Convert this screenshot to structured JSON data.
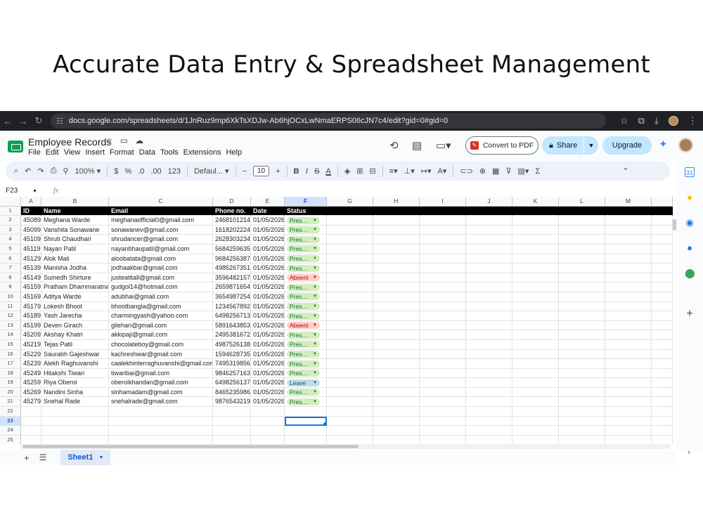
{
  "headline": "Accurate Data Entry & Spreadsheet Management",
  "browser": {
    "url": "docs.google.com/spreadsheets/d/1JnRuz9mp6XkTsXDJw-Ab6hjOCxLwNmaERPS06cJN7c4/edit?gid=0#gid=0",
    "icons": [
      "back-icon",
      "forward-icon",
      "reload-icon",
      "site-info-icon",
      "star-icon",
      "extensions-icon",
      "download-icon",
      "profile-icon",
      "menu-icon"
    ]
  },
  "sheets": {
    "title": "Employee Records",
    "menu": [
      "File",
      "Edit",
      "View",
      "Insert",
      "Format",
      "Data",
      "Tools",
      "Extensions",
      "Help"
    ],
    "convert_pdf_label": "Convert to PDF",
    "share_label": "Share",
    "upgrade_label": "Upgrade"
  },
  "toolbar": {
    "zoom": "100%",
    "currency": "$",
    "percent": "%",
    "dec_decrease": ".0",
    "dec_increase": ".00",
    "format_123": "123",
    "font": "Defaul...",
    "font_size": "10",
    "bold": "B",
    "italic": "I",
    "text_color": "A",
    "sum": "Σ"
  },
  "formula_bar": {
    "cell_ref": "F23",
    "fx": "fx",
    "value": ""
  },
  "columns": [
    "A",
    "B",
    "C",
    "D",
    "E",
    "F",
    "G",
    "H",
    "I",
    "J",
    "K",
    "L",
    "M"
  ],
  "header_row": [
    "ID",
    "Name",
    "Email",
    "Phone no.",
    "Date",
    "Status"
  ],
  "rows": [
    {
      "id": "45089",
      "name": "Meghana Warde",
      "email": "meghanaofficial0@gmail.com",
      "phone": "2468101214",
      "date": "01/05/2026",
      "status": "Pres...",
      "status_type": "present"
    },
    {
      "id": "45099",
      "name": "Vanshita Sonawane",
      "email": "sonawanev@gmail.com",
      "phone": "1618202224",
      "date": "01/05/2026",
      "status": "Pres...",
      "status_type": "present"
    },
    {
      "id": "45109",
      "name": "Shruti Chaudhari",
      "email": "shrudancer@gmail.com",
      "phone": "2628303234",
      "date": "01/05/2026",
      "status": "Pres...",
      "status_type": "present"
    },
    {
      "id": "45119",
      "name": "Nayan Patil",
      "email": "nayanbhaupatil@gmail.com",
      "phone": "5684259635",
      "date": "01/05/2026",
      "status": "Pres...",
      "status_type": "present"
    },
    {
      "id": "45129",
      "name": "Alok Mali",
      "email": "aloobatata@gmail.com",
      "phone": "9684256387",
      "date": "01/05/2026",
      "status": "Pres...",
      "status_type": "present"
    },
    {
      "id": "45139",
      "name": "Manisha Jodha",
      "email": "jodhaakbar@gmail.com",
      "phone": "4985267351",
      "date": "01/05/2026",
      "status": "Pres...",
      "status_type": "present"
    },
    {
      "id": "45149",
      "name": "Sumedh Shirture",
      "email": "justeatitall@gmail.com",
      "phone": "3596482157",
      "date": "01/05/2026",
      "status": "Absent",
      "status_type": "absent"
    },
    {
      "id": "45159",
      "name": "Pratham Dhammaratna",
      "email": "gudgol14@hotmail.com",
      "phone": "2659871654",
      "date": "01/05/2026",
      "status": "Pres...",
      "status_type": "present"
    },
    {
      "id": "45169",
      "name": "Aditya Warde",
      "email": "adubhai@gmail.com",
      "phone": "3654987254",
      "date": "01/05/2026",
      "status": "Pres...",
      "status_type": "present"
    },
    {
      "id": "45179",
      "name": "Lokesh Bhoot",
      "email": "bhootbangla@gmail.com",
      "phone": "1234567892",
      "date": "01/05/2026",
      "status": "Pres...",
      "status_type": "present"
    },
    {
      "id": "45189",
      "name": "Yash Jarecha",
      "email": "charmingyash@yahoo.com",
      "phone": "6498256713",
      "date": "01/05/2026",
      "status": "Pres...",
      "status_type": "present"
    },
    {
      "id": "45199",
      "name": "Deven Girach",
      "email": "gilehari@gmail.com",
      "phone": "5891643853",
      "date": "01/05/2026",
      "status": "Absent",
      "status_type": "absent"
    },
    {
      "id": "45209",
      "name": "Akshay Khatri",
      "email": "akkipaji@gmail.com",
      "phone": "2495381672",
      "date": "01/05/2026",
      "status": "Pres...",
      "status_type": "present"
    },
    {
      "id": "45219",
      "name": "Tejas Patil",
      "email": "chocolateboy@gmail.com",
      "phone": "4987526138",
      "date": "01/05/2026",
      "status": "Pres...",
      "status_type": "present"
    },
    {
      "id": "45229",
      "name": "Saurabh Gajeshwar",
      "email": "kachreshwar@gmail.com",
      "phone": "1594628735",
      "date": "01/05/2026",
      "status": "Pres...",
      "status_type": "present"
    },
    {
      "id": "45239",
      "name": "Alekh Raghuvanshi",
      "email": "caalekhinterraghuvanshi@gmail.com",
      "phone": "7495319856",
      "date": "01/05/2026",
      "status": "Pres...",
      "status_type": "present"
    },
    {
      "id": "45249",
      "name": "Hitakshi Tiwari",
      "email": "tiwaribai@gmail.com",
      "phone": "9846257163",
      "date": "01/05/2026",
      "status": "Pres...",
      "status_type": "present"
    },
    {
      "id": "45259",
      "name": "Riya Oberoi",
      "email": "oberoikhandan@gmail.com",
      "phone": "6498256137",
      "date": "01/05/2026",
      "status": "Leave",
      "status_type": "leave"
    },
    {
      "id": "45269",
      "name": "Nandini Sinha",
      "email": "sinhamadam@gmail.com",
      "phone": "8465235986",
      "date": "01/05/2026",
      "status": "Pres...",
      "status_type": "present"
    },
    {
      "id": "45279",
      "name": "Snehal Rade",
      "email": "snehalrade@gmail.com",
      "phone": "9876543219",
      "date": "01/05/2026",
      "status": "Pres...",
      "status_type": "present"
    }
  ],
  "empty_rows": [
    "22",
    "23",
    "24",
    "25"
  ],
  "selected_row": "23",
  "selected_col": "F",
  "sheet_tab": "Sheet1",
  "colors": {
    "present_bg": "#d4edbc",
    "present_fg": "#11734b",
    "absent_bg": "#ffcfc9",
    "absent_fg": "#b10202",
    "leave_bg": "#c6dbe1",
    "leave_fg": "#0a53a8",
    "header_bg": "#000000",
    "accent": "#1a73e8"
  }
}
